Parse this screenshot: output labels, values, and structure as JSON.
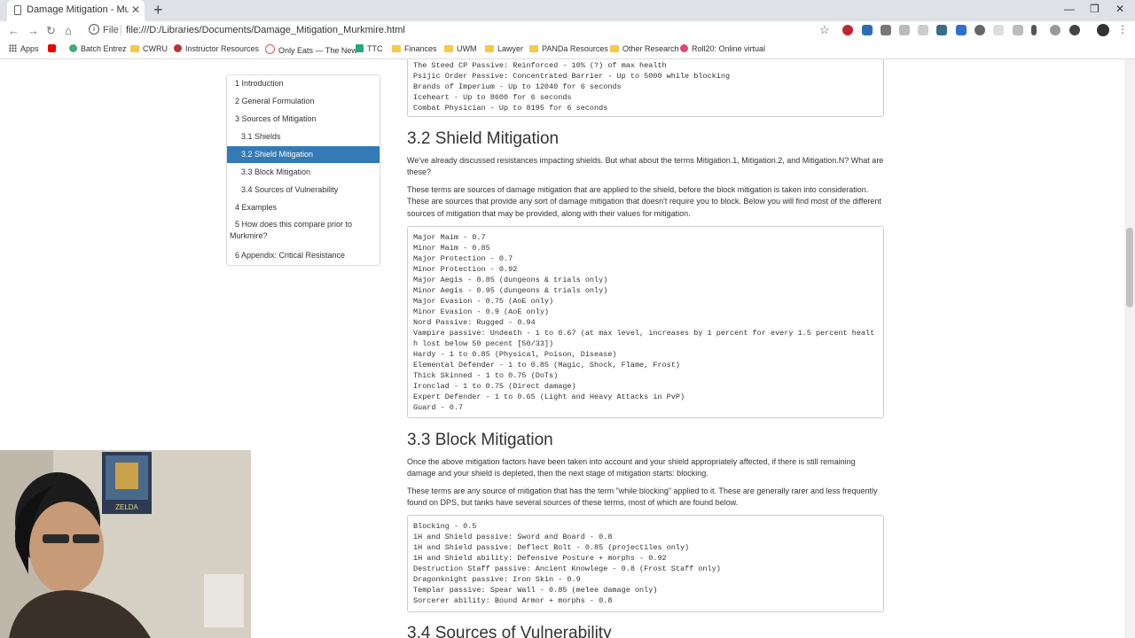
{
  "browser": {
    "tab_title": "Damage Mitigation - Murkmire",
    "url_label": "File",
    "url": "file:///D:/Libraries/Documents/Damage_Mitigation_Murkmire.html"
  },
  "bookmarks": [
    {
      "label": "Apps",
      "icon": "apps-grid-icon"
    },
    {
      "label": "",
      "icon": "youtube-icon"
    },
    {
      "label": "Batch Entrez",
      "icon": "ncbi-icon"
    },
    {
      "label": "CWRU",
      "icon": "folder-icon"
    },
    {
      "label": "Instructor Resources",
      "icon": "site-icon"
    },
    {
      "label": "Only Eats — The New",
      "icon": "site-icon"
    },
    {
      "label": "TTC",
      "icon": "site-icon"
    },
    {
      "label": "Finances",
      "icon": "folder-icon"
    },
    {
      "label": "UWM",
      "icon": "folder-icon"
    },
    {
      "label": "Lawyer",
      "icon": "folder-icon"
    },
    {
      "label": "PANDa Resources",
      "icon": "folder-icon"
    },
    {
      "label": "Other Research",
      "icon": "folder-icon"
    },
    {
      "label": "Roll20: Online virtual",
      "icon": "roll20-icon"
    }
  ],
  "toc": [
    {
      "label": "1 Introduction",
      "active": false
    },
    {
      "label": "2 General Formulation",
      "active": false
    },
    {
      "label": "3 Sources of Mitigation",
      "active": false
    },
    {
      "label": "3.1 Shields",
      "active": false
    },
    {
      "label": "3.2 Shield Mitigation",
      "active": true
    },
    {
      "label": "3.3 Block Mitigation",
      "active": false
    },
    {
      "label": "3.4 Sources of Vulnerability",
      "active": false
    },
    {
      "label": "4 Examples",
      "active": false
    },
    {
      "label": "5 How does this compare prior to Murkmire?",
      "active": false
    },
    {
      "label": "6 Appendix: Critical Resistance",
      "active": false
    }
  ],
  "top_pre": [
    "The Steed CP Passive: Reinforced - 10% (?) of max health",
    "Psijic Order Passive: Concentrated Barrier - Up to 5000 while blocking",
    "Brands of Imperium - Up to 12040 for 6 seconds",
    "Iceheart - Up to 8600 for 6 seconds",
    "Combat Physician - Up to 8195 for 6 seconds"
  ],
  "section_32": {
    "heading": "3.2 Shield Mitigation",
    "para1": "We've already discussed resistances impacting shields. But what about the terms Mitigation.1, Mitigation.2, and Mitigation.N? What are these?",
    "para2": "These terms are sources of damage mitigation that are applied to the shield, before the block mitigation is taken into consideration. These are sources that provide any sort of damage mitigation that doesn't require you to block. Below you will find most of the different sources of mitigation that may be provided, along with their values for mitigation.",
    "lines": [
      "Major Maim - 0.7",
      "Minor Maim - 0.85",
      "Major Protection - 0.7",
      "Minor Protection - 0.92",
      "Major Aegis - 0.85 (dungeons & trials only)",
      "Minor Aegis - 0.95 (dungeons & trials only)",
      "Major Evasion - 0.75 (AoE only)",
      "Minor Evasion - 0.9 (AoE only)",
      "Nord Passive: Rugged - 0.94",
      "Vampire passive: Undeath - 1 to 0.67 (at max level, increases by 1 percent for every 1.5 percent health lost below 50 pecent [50/33])",
      "Hardy - 1 to 0.85 (Physical, Poison, Disease)",
      "Elemental Defender - 1 to 0.85 (Magic, Shock, Flame, Frost)",
      "Thick Skinned - 1 to 0.75 (DoTs)",
      "Ironclad - 1 to 0.75 (Direct damage)",
      "Expert Defender - 1 to 0.65 (Light and Heavy Attacks in PvP)",
      "Guard - 0.7"
    ]
  },
  "section_33": {
    "heading": "3.3 Block Mitigation",
    "para1": "Once the above mitigation factors have been taken into account and your shield appropriately affected, if there is still remaining damage and your shield is depleted, then the next stage of mitigation starts: blocking.",
    "para2": "These terms are any source of mitigation that has the term \"while blocking\" applied to it. These are generally rarer and less frequently found on DPS, but tanks have several sources of these terms, most of which are found below.",
    "lines": [
      "Blocking - 0.5",
      "1H and Shield passive: Sword and Board - 0.8",
      "1H and Shield passive: Deflect Bolt - 0.85 (projectiles only)",
      "1H and Shield ability: Defensive Posture + morphs - 0.92",
      "Destruction Staff passive: Ancient Knowlege - 0.8 (Frost Staff only)",
      "Dragonknight passive: Iron Skin - 0.9",
      "Templar passive: Spear Wall - 0.85 (melee damage only)",
      "Sorcerer ability: Bound Armor + morphs - 0.8"
    ]
  },
  "section_34": {
    "heading": "3.4 Sources of Vulnerability"
  },
  "webcam": {
    "poster_text": "ZELDA"
  }
}
